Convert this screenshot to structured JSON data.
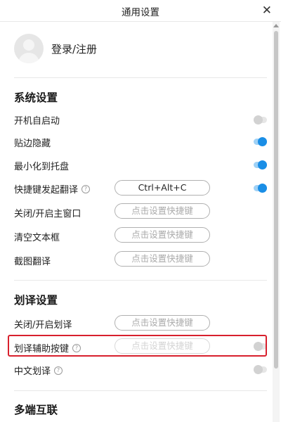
{
  "window": {
    "title": "通用设置",
    "close_icon": "close-icon"
  },
  "user": {
    "login_label": "登录/注册"
  },
  "system": {
    "section_title": "系统设置",
    "autostart": {
      "label": "开机自启动",
      "enabled": false
    },
    "edge_hide": {
      "label": "贴边隐藏",
      "enabled": true
    },
    "minimize_to_tray": {
      "label": "最小化到托盘",
      "enabled": true
    },
    "hotkey_translate": {
      "label": "快捷键发起翻译",
      "hotkey": "Ctrl+Alt+C",
      "enabled": true
    },
    "toggle_main_window": {
      "label": "关闭/开启主窗口",
      "hotkey_placeholder": "点击设置快捷键"
    },
    "clear_textbox": {
      "label": "清空文本框",
      "hotkey_placeholder": "点击设置快捷键"
    },
    "screenshot_translate": {
      "label": "截图翻译",
      "hotkey_placeholder": "点击设置快捷键"
    }
  },
  "selection": {
    "section_title": "划译设置",
    "toggle_selection": {
      "label": "关闭/开启划译",
      "hotkey_placeholder": "点击设置快捷键"
    },
    "assist_key": {
      "label": "划译辅助按键",
      "hotkey_placeholder": "点击设置快捷键",
      "enabled": false
    },
    "chinese_selection": {
      "label": "中文划译",
      "enabled": false
    }
  },
  "multi_device": {
    "section_title": "多端互联"
  },
  "help_icon_glyph": "?",
  "colors": {
    "accent": "#1a8ee6",
    "highlight_border": "#d8202d"
  }
}
